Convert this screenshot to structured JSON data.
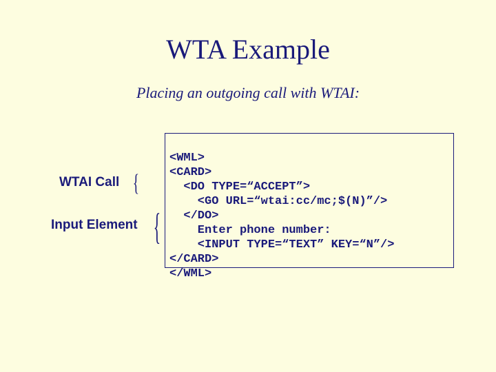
{
  "title": "WTA Example",
  "subtitle": "Placing an outgoing call with WTAI:",
  "label_wtai": "WTAI Call",
  "label_input": "Input Element",
  "code": {
    "l1": "<WML>",
    "l2": "<CARD>",
    "l3": "  <DO TYPE=“ACCEPT”>",
    "l4": "    <GO URL=“wtai:cc/mc;$(N)”/>",
    "l5": "  </DO>",
    "l6": "    Enter phone number:",
    "l7": "    <INPUT TYPE=“TEXT” KEY=“N”/>",
    "l8": "</CARD>",
    "l9": "</WML>"
  }
}
